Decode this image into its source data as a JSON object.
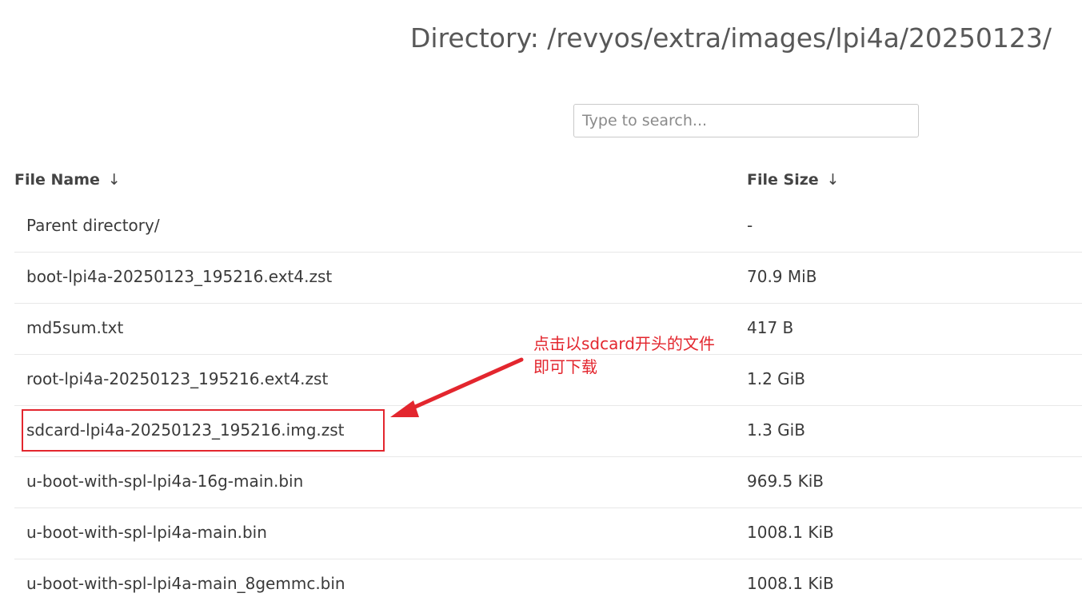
{
  "title": "Directory: /revyos/extra/images/lpi4a/20250123/",
  "search": {
    "placeholder": "Type to search..."
  },
  "table": {
    "headers": {
      "name": "File Name",
      "size": "File Size",
      "sort_icon": "↓"
    },
    "rows": [
      {
        "name": "Parent directory/",
        "size": "-"
      },
      {
        "name": "boot-lpi4a-20250123_195216.ext4.zst",
        "size": "70.9 MiB"
      },
      {
        "name": "md5sum.txt",
        "size": "417 B"
      },
      {
        "name": "root-lpi4a-20250123_195216.ext4.zst",
        "size": "1.2 GiB"
      },
      {
        "name": "sdcard-lpi4a-20250123_195216.img.zst",
        "size": "1.3 GiB"
      },
      {
        "name": "u-boot-with-spl-lpi4a-16g-main.bin",
        "size": "969.5 KiB"
      },
      {
        "name": "u-boot-with-spl-lpi4a-main.bin",
        "size": "1008.1 KiB"
      },
      {
        "name": "u-boot-with-spl-lpi4a-main_8gemmc.bin",
        "size": "1008.1 KiB"
      }
    ]
  },
  "annotation": {
    "line1": "点击以sdcard开头的文件",
    "line2": "即可下载",
    "color": "#e3262e"
  }
}
